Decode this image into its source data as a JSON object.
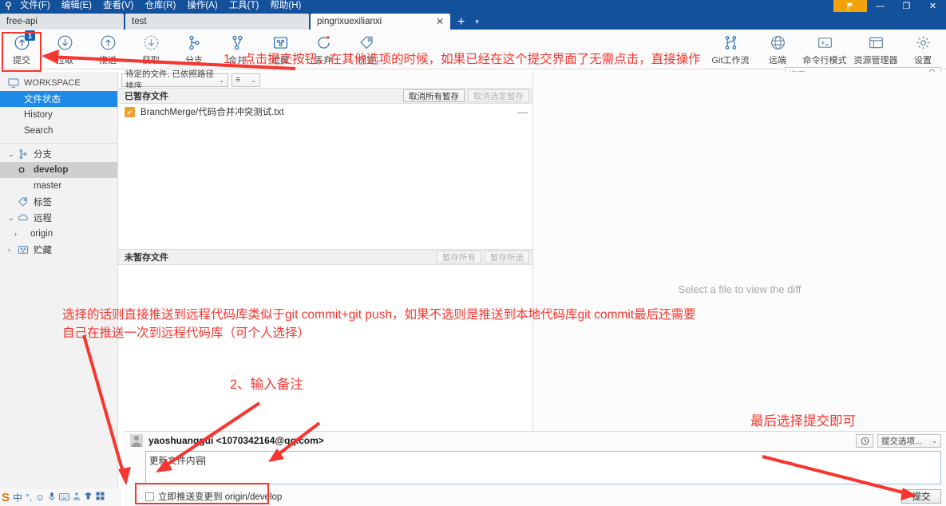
{
  "window": {
    "menus": [
      "文件(F)",
      "编辑(E)",
      "查看(V)",
      "仓库(R)",
      "操作(A)",
      "工具(T)",
      "帮助(H)"
    ],
    "minimize": "—",
    "maximize": "❐",
    "close": "✕",
    "flag_icon": "flag-icon",
    "hamburger": "≡",
    "titlebar_color": "#14519b"
  },
  "tabs": {
    "items": [
      {
        "label": "free-api",
        "active": false
      },
      {
        "label": "test",
        "active": false
      },
      {
        "label": "pingrixuexilianxi",
        "active": true
      }
    ],
    "close_glyph": "✕",
    "add_glyph": "+",
    "dropdown_glyph": "▾"
  },
  "toolbar": {
    "left": [
      {
        "label": "提交",
        "icon": "commit-icon",
        "badge": "1"
      },
      {
        "label": "拉取",
        "icon": "pull-icon"
      },
      {
        "label": "推送",
        "icon": "push-icon"
      },
      {
        "label": "获取",
        "icon": "fetch-icon"
      },
      {
        "label": "分支",
        "icon": "branch-icon"
      },
      {
        "label": "合并",
        "icon": "merge-icon"
      },
      {
        "label": "贮藏",
        "icon": "stash-icon"
      },
      {
        "label": "丢弃",
        "icon": "discard-icon"
      },
      {
        "label": "标签",
        "icon": "tag-icon"
      }
    ],
    "right": [
      {
        "label": "Git工作流",
        "icon": "gitflow-icon"
      },
      {
        "label": "远端",
        "icon": "remote-globe-icon"
      },
      {
        "label": "命令行模式",
        "icon": "terminal-icon"
      },
      {
        "label": "资源管理器",
        "icon": "explorer-icon"
      },
      {
        "label": "设置",
        "icon": "gear-icon"
      }
    ]
  },
  "search": {
    "placeholder": "搜索",
    "icon": "search-icon"
  },
  "sidebar": {
    "workspace": {
      "label": "WORKSPACE",
      "icon": "monitor-icon"
    },
    "workspace_items": [
      {
        "label": "文件状态",
        "selected": true
      },
      {
        "label": "History",
        "selected": false
      },
      {
        "label": "Search",
        "selected": false
      }
    ],
    "branches": {
      "label": "分支",
      "icon": "branch-icon",
      "twist": "⌄"
    },
    "branch_items": [
      {
        "label": "develop",
        "active": true,
        "icon": "current-branch-dot"
      },
      {
        "label": "master",
        "active": false
      }
    ],
    "tags": {
      "label": "标签",
      "icon": "tag-icon"
    },
    "remotes": {
      "label": "远程",
      "icon": "cloud-icon",
      "twist": "⌄"
    },
    "remote_items": [
      {
        "label": "origin",
        "twist": "›"
      }
    ],
    "stashes": {
      "label": "贮藏",
      "icon": "stash-icon",
      "twist": "›"
    }
  },
  "files": {
    "filter_label": "待定的文件, 已依照路径排序",
    "filter_arrow": "⌄",
    "view_icon": "list-view-icon",
    "view_arrow": "⌄",
    "staged": {
      "title": "已暂存文件",
      "unstage_all": "取消所有暂存",
      "unstage_selected": "取消选定暂存",
      "rows": [
        {
          "path": "BranchMerge/代码合并冲突测试.txt",
          "status": "modified",
          "remove_glyph": "—"
        }
      ]
    },
    "unstaged": {
      "title": "未暂存文件",
      "stage_all": "暂存所有",
      "stage_selected": "暂存所选",
      "rows": []
    }
  },
  "diff": {
    "hint": "Select a file to view the diff"
  },
  "commit": {
    "author": "yaoshuanggui <1070342164@qq.com>",
    "avatar": "avatar-icon",
    "history_icon": "clock-icon",
    "options_label": "提交选项...",
    "options_arrow": "⌄",
    "message": "更新文件内容",
    "push_checkbox_label": "立即推送变更到 origin/develop",
    "push_checked": false,
    "commit_button": "提交"
  },
  "ime": {
    "logo": "sogou-icon",
    "items": [
      "中",
      "°,",
      "☺",
      "🎤",
      "⌨",
      "👤",
      "👕",
      "▦"
    ]
  },
  "annotations": {
    "step1": "1、点击提交按钮，在其他选项的时候，如果已经在这个提交界面了无需点击，直接操作",
    "note_push_line1": "选择的话则直接推送到远程代码库类似于git commit+git push，如果不选则是推送到本地代码库git commit最后还需要",
    "note_push_line2": "自己在推送一次到远程代码库（可个人选择）",
    "step2": "2、输入备注",
    "step3": "最后选择提交即可",
    "color": "#f8352e"
  }
}
